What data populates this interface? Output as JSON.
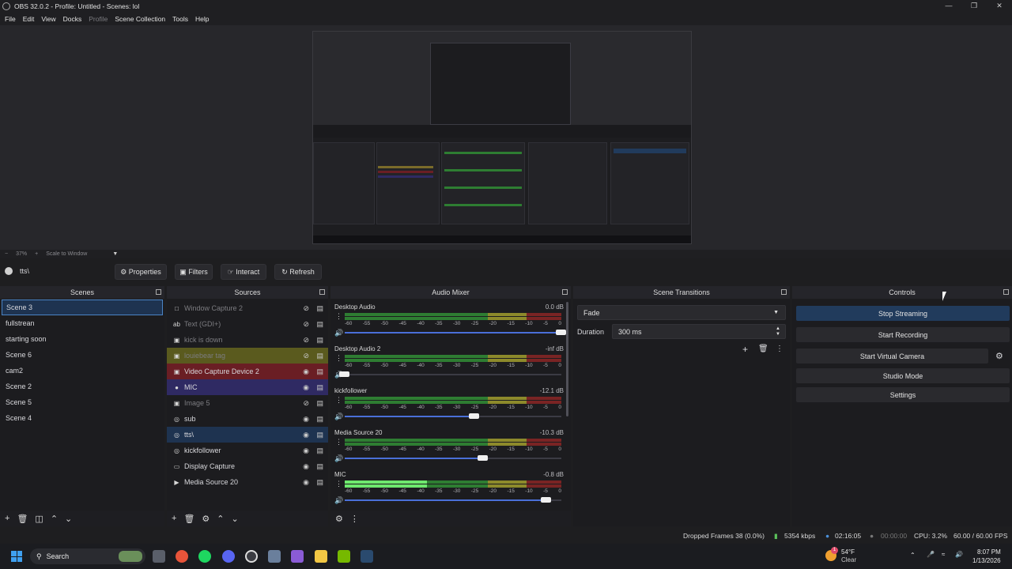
{
  "window": {
    "title": "OBS 32.0.2 - Profile: Untitled - Scenes: lol"
  },
  "menu": [
    "File",
    "Edit",
    "View",
    "Docks",
    "Profile",
    "Scene Collection",
    "Tools",
    "Help"
  ],
  "preview_bar": {
    "zoom": "37%",
    "scale_label": "Scale to Window"
  },
  "context": {
    "source_name": "tts\\",
    "buttons": {
      "properties": "Properties",
      "filters": "Filters",
      "interact": "Interact",
      "refresh": "Refresh"
    }
  },
  "docks": {
    "scenes": "Scenes",
    "sources": "Sources",
    "mixer": "Audio Mixer",
    "transitions": "Scene Transitions",
    "controls": "Controls"
  },
  "scenes": [
    "Scene 3",
    "fullstrean",
    "starting soon",
    "Scene 6",
    "cam2",
    "Scene 2",
    "Scene 5",
    "Scene 4"
  ],
  "sources": [
    {
      "name": "Window Capture 2",
      "icon": "window-icon",
      "visible": false,
      "color": ""
    },
    {
      "name": "Text (GDI+)",
      "icon": "text-icon",
      "visible": false,
      "color": ""
    },
    {
      "name": "kick is down",
      "icon": "image-icon",
      "visible": false,
      "color": ""
    },
    {
      "name": "louiebear tag",
      "icon": "image-icon",
      "visible": false,
      "color": "#5a5a1e"
    },
    {
      "name": "Video Capture Device 2",
      "icon": "camera-icon",
      "visible": true,
      "color": "#6a1e24"
    },
    {
      "name": "MIC",
      "icon": "mic-icon",
      "visible": true,
      "color": "#2f2a63"
    },
    {
      "name": "Image 5",
      "icon": "image-icon",
      "visible": false,
      "color": ""
    },
    {
      "name": "sub",
      "icon": "globe-icon",
      "visible": true,
      "color": ""
    },
    {
      "name": "tts\\",
      "icon": "globe-icon",
      "visible": true,
      "color": "#1e3350"
    },
    {
      "name": "kickfollower",
      "icon": "globe-icon",
      "visible": true,
      "color": ""
    },
    {
      "name": "Display Capture",
      "icon": "monitor-icon",
      "visible": true,
      "color": ""
    },
    {
      "name": "Media Source 20",
      "icon": "play-icon",
      "visible": true,
      "color": ""
    }
  ],
  "mixer": {
    "ticks": [
      "-60",
      "-55",
      "-50",
      "-45",
      "-40",
      "-35",
      "-30",
      "-25",
      "-20",
      "-15",
      "-10",
      "-5",
      "0"
    ],
    "channels": [
      {
        "name": "Desktop Audio",
        "db": "0.0 dB",
        "volume": 1.0,
        "level": 0.0
      },
      {
        "name": "Desktop Audio 2",
        "db": "-inf dB",
        "volume": 0.0,
        "level": 0.0
      },
      {
        "name": "kickfollower",
        "db": "-12.1 dB",
        "volume": 0.6,
        "level": 0.0
      },
      {
        "name": "Media Source 20",
        "db": "-10.3 dB",
        "volume": 0.64,
        "level": 0.0
      },
      {
        "name": "MIC",
        "db": "-0.8 dB",
        "volume": 0.93,
        "level": 0.38
      }
    ]
  },
  "transitions": {
    "selected": "Fade",
    "duration_label": "Duration",
    "duration_value": "300 ms"
  },
  "controls": {
    "stop_streaming": "Stop Streaming",
    "start_recording": "Start Recording",
    "start_virtual_camera": "Start Virtual Camera",
    "studio_mode": "Studio Mode",
    "settings": "Settings"
  },
  "status": {
    "dropped": "Dropped Frames 38 (0.0%)",
    "bitrate": "5354 kbps",
    "stream_time": "02:16:05",
    "record_time": "00:00:00",
    "cpu": "CPU: 3.2%",
    "fps": "60.00 / 60.00 FPS"
  },
  "taskbar": {
    "search": "Search",
    "weather_temp": "54°F",
    "weather_desc": "Clear",
    "time": "8:07 PM",
    "date": "1/13/2026",
    "badge": "1"
  }
}
